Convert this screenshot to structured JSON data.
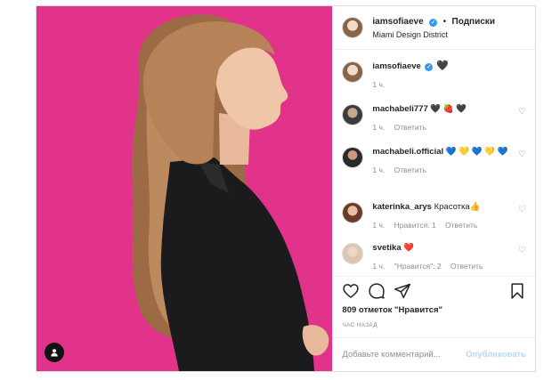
{
  "post": {
    "photo_bg_color": "#e2338a",
    "header": {
      "username": "iamsofiaeve",
      "follow_label": "Подписки",
      "separator": "•",
      "location": "Miami Design District"
    },
    "caption": {
      "username": "iamsofiaeve",
      "text": "🖤",
      "time": "1 ч."
    },
    "comments": [
      {
        "username": "machabeli777",
        "text": "🖤 🍓 🖤",
        "time": "1 ч.",
        "likes": "",
        "reply": "Ответить"
      },
      {
        "username": "machabeli.official",
        "text": "💙 💛 💙 💛 💙",
        "time": "1 ч.",
        "likes": "",
        "reply": "Ответить"
      },
      {
        "username": "katerinka_arys",
        "text": "Красотка👍",
        "time": "1 ч.",
        "likes": "Нравится: 1",
        "reply": "Ответить"
      },
      {
        "username": "svetika",
        "text": "❤️",
        "time": "1 ч.",
        "likes": "\"Нравится\": 2",
        "reply": "Ответить"
      }
    ],
    "likes_count": "809 отметок \"Нравится\"",
    "timestamp": "ЧАС НАЗАД",
    "comment_placeholder": "Добавьте комментарий...",
    "publish_label": "Опубликовать"
  }
}
